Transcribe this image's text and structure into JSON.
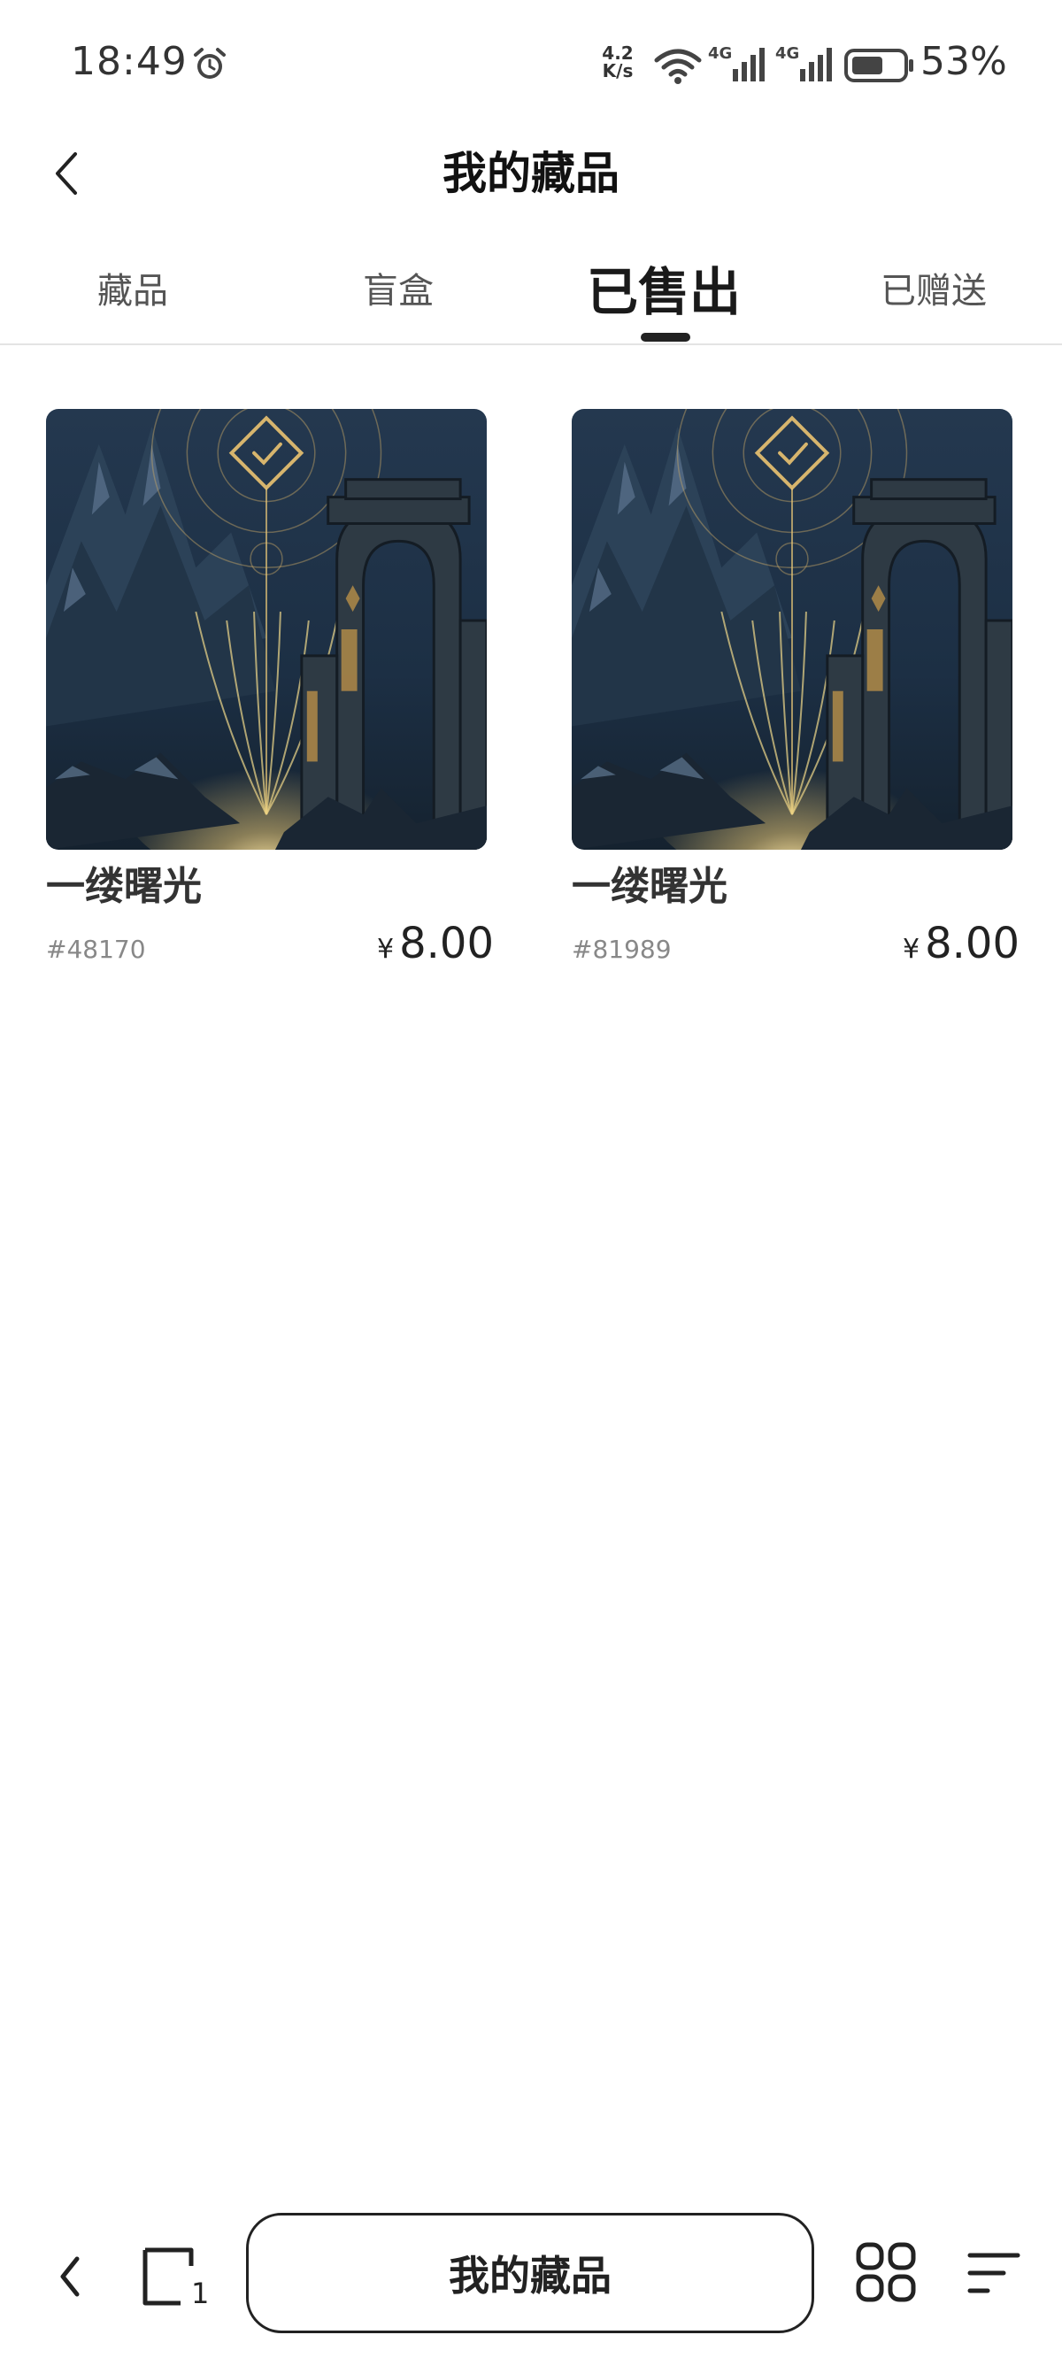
{
  "status_bar": {
    "time": "18:49",
    "net_speed_value": "4.2",
    "net_speed_unit": "K/s",
    "signal1_label": "4G",
    "signal2_label": "4G",
    "battery_percent": "53%"
  },
  "header": {
    "title": "我的藏品"
  },
  "tabs": [
    {
      "label": "藏品",
      "active": false
    },
    {
      "label": "盲盒",
      "active": false
    },
    {
      "label": "已售出",
      "active": true
    },
    {
      "label": "已赠送",
      "active": false
    }
  ],
  "items": [
    {
      "name": "一缕曙光",
      "id": "#48170",
      "currency": "¥",
      "price": "8.00"
    },
    {
      "name": "一缕曙光",
      "id": "#81989",
      "currency": "¥",
      "price": "8.00"
    }
  ],
  "bottom_bar": {
    "center_label": "我的藏品",
    "tab_count": "1"
  },
  "colors": {
    "primary_text": "#1a1a1a",
    "muted_text": "#888888",
    "divider": "#e4e4e4",
    "artwork_gold": "#e8c877",
    "artwork_night": "#1c2f44"
  },
  "icons": [
    "alarm-icon",
    "wifi-icon",
    "signal-icon",
    "battery-icon",
    "chevron-left-icon",
    "tabs-icon",
    "grid-icon",
    "menu-icon"
  ]
}
